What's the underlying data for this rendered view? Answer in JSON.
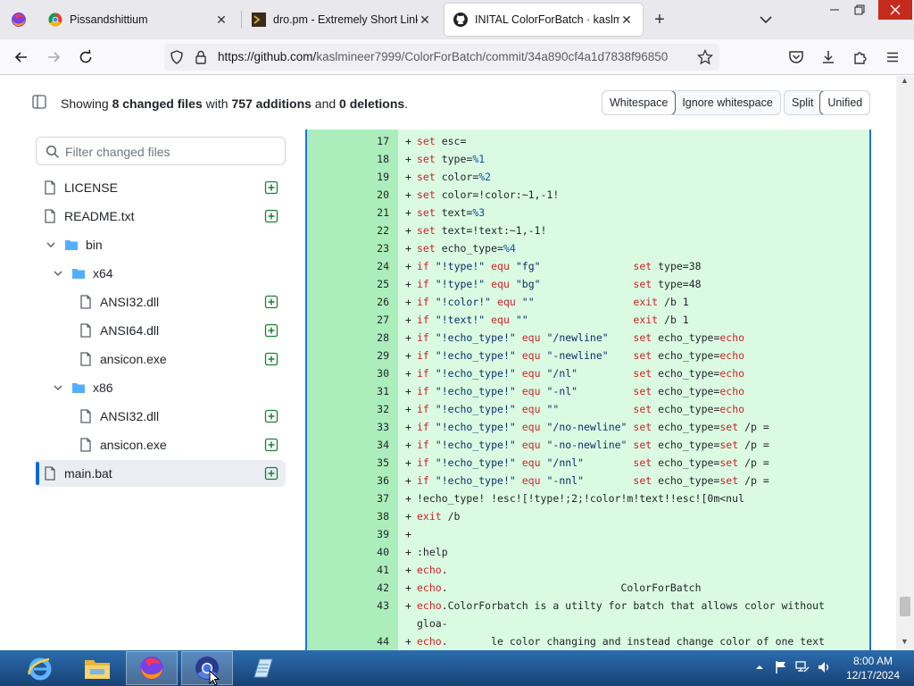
{
  "browser": {
    "tabs": [
      {
        "title": "Pissandshittium",
        "active": false
      },
      {
        "title": "dro.pm - Extremely Short Links",
        "active": false
      },
      {
        "title": "INITAL ColorForBatch · kaslmi",
        "active": true
      }
    ],
    "url_main": "https://github.com/",
    "url_path": "kaslmineer7999/ColorForBatch/commit/34a890cf4a1d7838f96850"
  },
  "diff": {
    "summary_prefix": "Showing ",
    "changed_files": "8 changed files",
    "summary_with": " with ",
    "additions": "757 additions",
    "summary_and": " and ",
    "deletions": "0 deletions",
    "summary_end": ".",
    "whitespace_label": "Whitespace",
    "ignore_whitespace_label": "Ignore whitespace",
    "split_label": "Split",
    "unified_label": "Unified"
  },
  "file_tree": {
    "filter_placeholder": "Filter changed files",
    "items": [
      {
        "label": "LICENSE",
        "type": "file",
        "added": true
      },
      {
        "label": "README.txt",
        "type": "file",
        "added": true
      },
      {
        "label": "bin",
        "type": "folder",
        "added": false
      },
      {
        "label": "x64",
        "type": "folder",
        "added": false
      },
      {
        "label": "ANSI32.dll",
        "type": "file",
        "added": true
      },
      {
        "label": "ANSI64.dll",
        "type": "file",
        "added": true
      },
      {
        "label": "ansicon.exe",
        "type": "file",
        "added": true
      },
      {
        "label": "x86",
        "type": "folder",
        "added": false
      },
      {
        "label": "ANSI32.dll",
        "type": "file",
        "added": true
      },
      {
        "label": "ansicon.exe",
        "type": "file",
        "added": true
      },
      {
        "label": "main.bat",
        "type": "file",
        "added": true
      }
    ]
  },
  "code_lines": [
    {
      "n": "17",
      "text": "set esc="
    },
    {
      "n": "18",
      "text": "set type=%1"
    },
    {
      "n": "19",
      "text": "set color=%2"
    },
    {
      "n": "20",
      "text": "set color=!color:~1,-1!"
    },
    {
      "n": "21",
      "text": "set text=%3"
    },
    {
      "n": "22",
      "text": "set text=!text:~1,-1!"
    },
    {
      "n": "23",
      "text": "set echo_type=%4"
    },
    {
      "n": "24",
      "text": "if \"!type!\" equ \"fg\"               set type=38"
    },
    {
      "n": "25",
      "text": "if \"!type!\" equ \"bg\"               set type=48"
    },
    {
      "n": "26",
      "text": "if \"!color!\" equ \"\"                exit /b 1"
    },
    {
      "n": "27",
      "text": "if \"!text!\" equ \"\"                 exit /b 1"
    },
    {
      "n": "28",
      "text": "if \"!echo_type!\" equ \"/newline\"    set echo_type=echo"
    },
    {
      "n": "29",
      "text": "if \"!echo_type!\" equ \"-newline\"    set echo_type=echo"
    },
    {
      "n": "30",
      "text": "if \"!echo_type!\" equ \"/nl\"         set echo_type=echo"
    },
    {
      "n": "31",
      "text": "if \"!echo_type!\" equ \"-nl\"         set echo_type=echo"
    },
    {
      "n": "32",
      "text": "if \"!echo_type!\" equ \"\"            set echo_type=echo"
    },
    {
      "n": "33",
      "text": "if \"!echo_type!\" equ \"/no-newline\" set echo_type=set /p ="
    },
    {
      "n": "34",
      "text": "if \"!echo_type!\" equ \"-no-newline\" set echo_type=set /p ="
    },
    {
      "n": "35",
      "text": "if \"!echo_type!\" equ \"/nnl\"        set echo_type=set /p ="
    },
    {
      "n": "36",
      "text": "if \"!echo_type!\" equ \"-nnl\"        set echo_type=set /p ="
    },
    {
      "n": "37",
      "text": "!echo_type! !esc![!type!;2;!color!m!text!!esc![0m<nul"
    },
    {
      "n": "38",
      "text": "exit /b"
    },
    {
      "n": "39",
      "text": ""
    },
    {
      "n": "40",
      "text": ":help"
    },
    {
      "n": "41",
      "text": "echo."
    },
    {
      "n": "42",
      "text": "echo.                            ColorForBatch"
    },
    {
      "n": "43",
      "text": "echo.ColorForbatch is a utilty for batch that allows color without"
    },
    {
      "n": "",
      "text": "gloa-"
    },
    {
      "n": "44",
      "text": "echo.       le color changing and instead change color of one text"
    }
  ],
  "taskbar": {
    "time": "8:00 AM",
    "date": "12/17/2024"
  },
  "colors": {
    "added_bg": "#dafbe1",
    "added_gutter": "#aceebb",
    "accent": "#0969da",
    "taskbar": "#1c4f8a"
  }
}
